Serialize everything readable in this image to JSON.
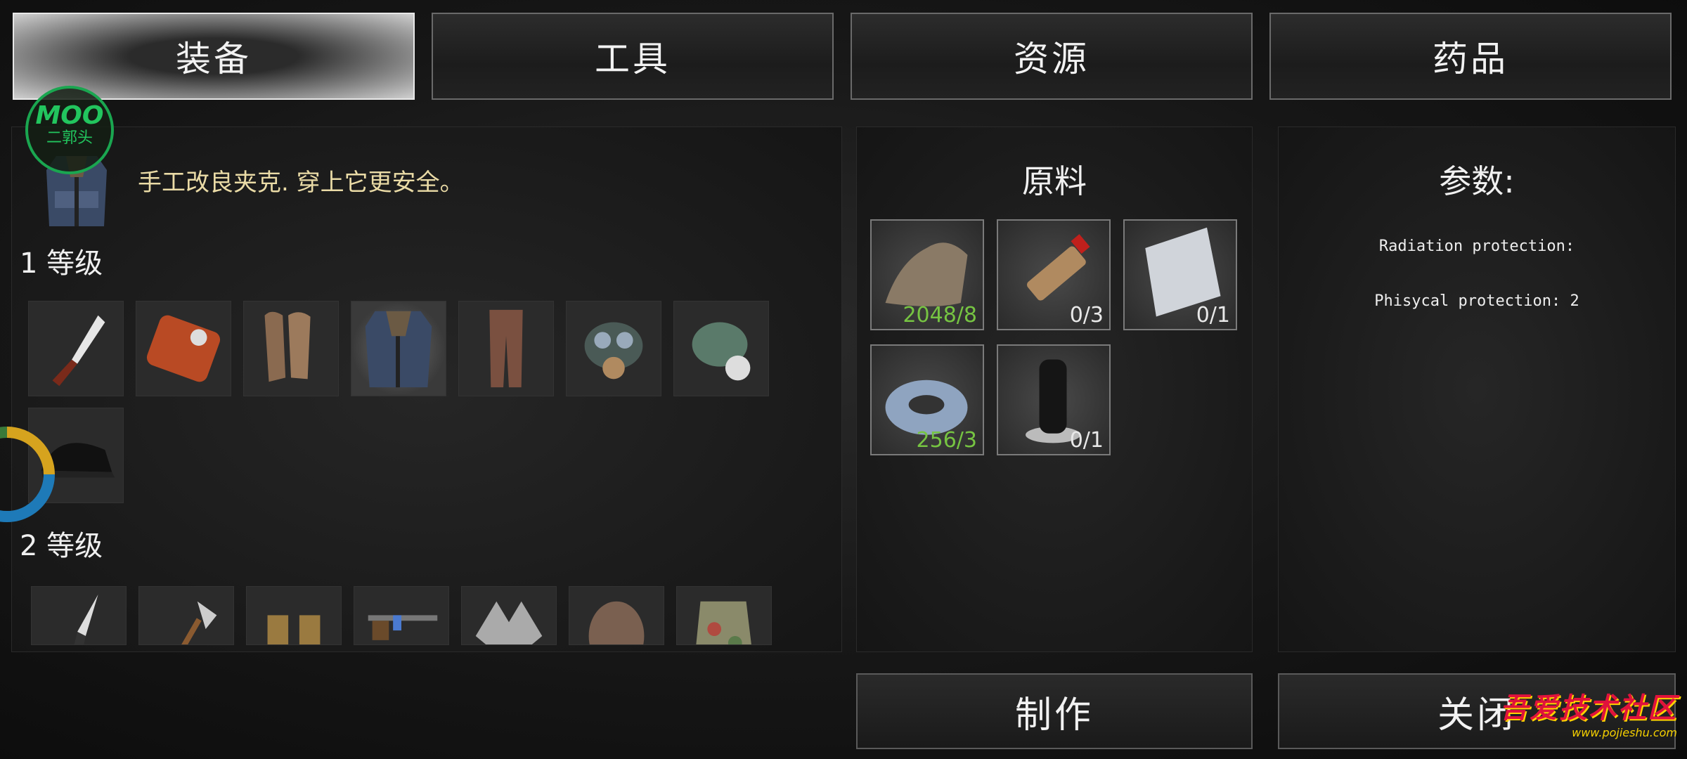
{
  "tabs": [
    {
      "label": "装备",
      "active": true
    },
    {
      "label": "工具",
      "active": false
    },
    {
      "label": "资源",
      "active": false
    },
    {
      "label": "药品",
      "active": false
    }
  ],
  "selected_item": {
    "description": "手工改良夹克. 穿上它更安全。",
    "icon": "jacket-icon"
  },
  "levels": [
    {
      "label": "1 等级",
      "items": [
        "knife-icon",
        "orange-case-icon",
        "gloves-icon",
        "jacket-icon",
        "pants-icon",
        "gas-mask-icon",
        "respirator-mask-icon",
        "helmet-icon"
      ]
    },
    {
      "label": "2 等级",
      "items": [
        "hunting-knife-icon",
        "axe-icon",
        "armor-vest-icon",
        "rifle-icon",
        "wolf-pelt-icon",
        "bear-pelt-icon",
        "camo-jacket-icon"
      ]
    }
  ],
  "materials": {
    "title": "原料",
    "items": [
      {
        "icon": "cloth-icon",
        "count": "2048/8",
        "enough": true
      },
      {
        "icon": "glue-tube-icon",
        "count": "0/3",
        "enough": false
      },
      {
        "icon": "metal-sheet-icon",
        "count": "0/1",
        "enough": false
      },
      {
        "icon": "duct-tape-icon",
        "count": "256/3",
        "enough": true
      },
      {
        "icon": "thread-spool-icon",
        "count": "0/1",
        "enough": false
      }
    ]
  },
  "params": {
    "title": "参数:",
    "lines": [
      "Radiation protection:",
      "Phisycal protection: 2"
    ]
  },
  "buttons": {
    "craft": "制作",
    "close": "关闭"
  },
  "overlay": {
    "logo_line1": "MOO",
    "logo_line2": "二郭头",
    "watermark_main": "吾爱技术社区",
    "watermark_url": "www.pojieshu.com"
  },
  "colors": {
    "enough": "#76c442",
    "not_enough": "#e8e8e8",
    "desc": "#eadba6"
  }
}
